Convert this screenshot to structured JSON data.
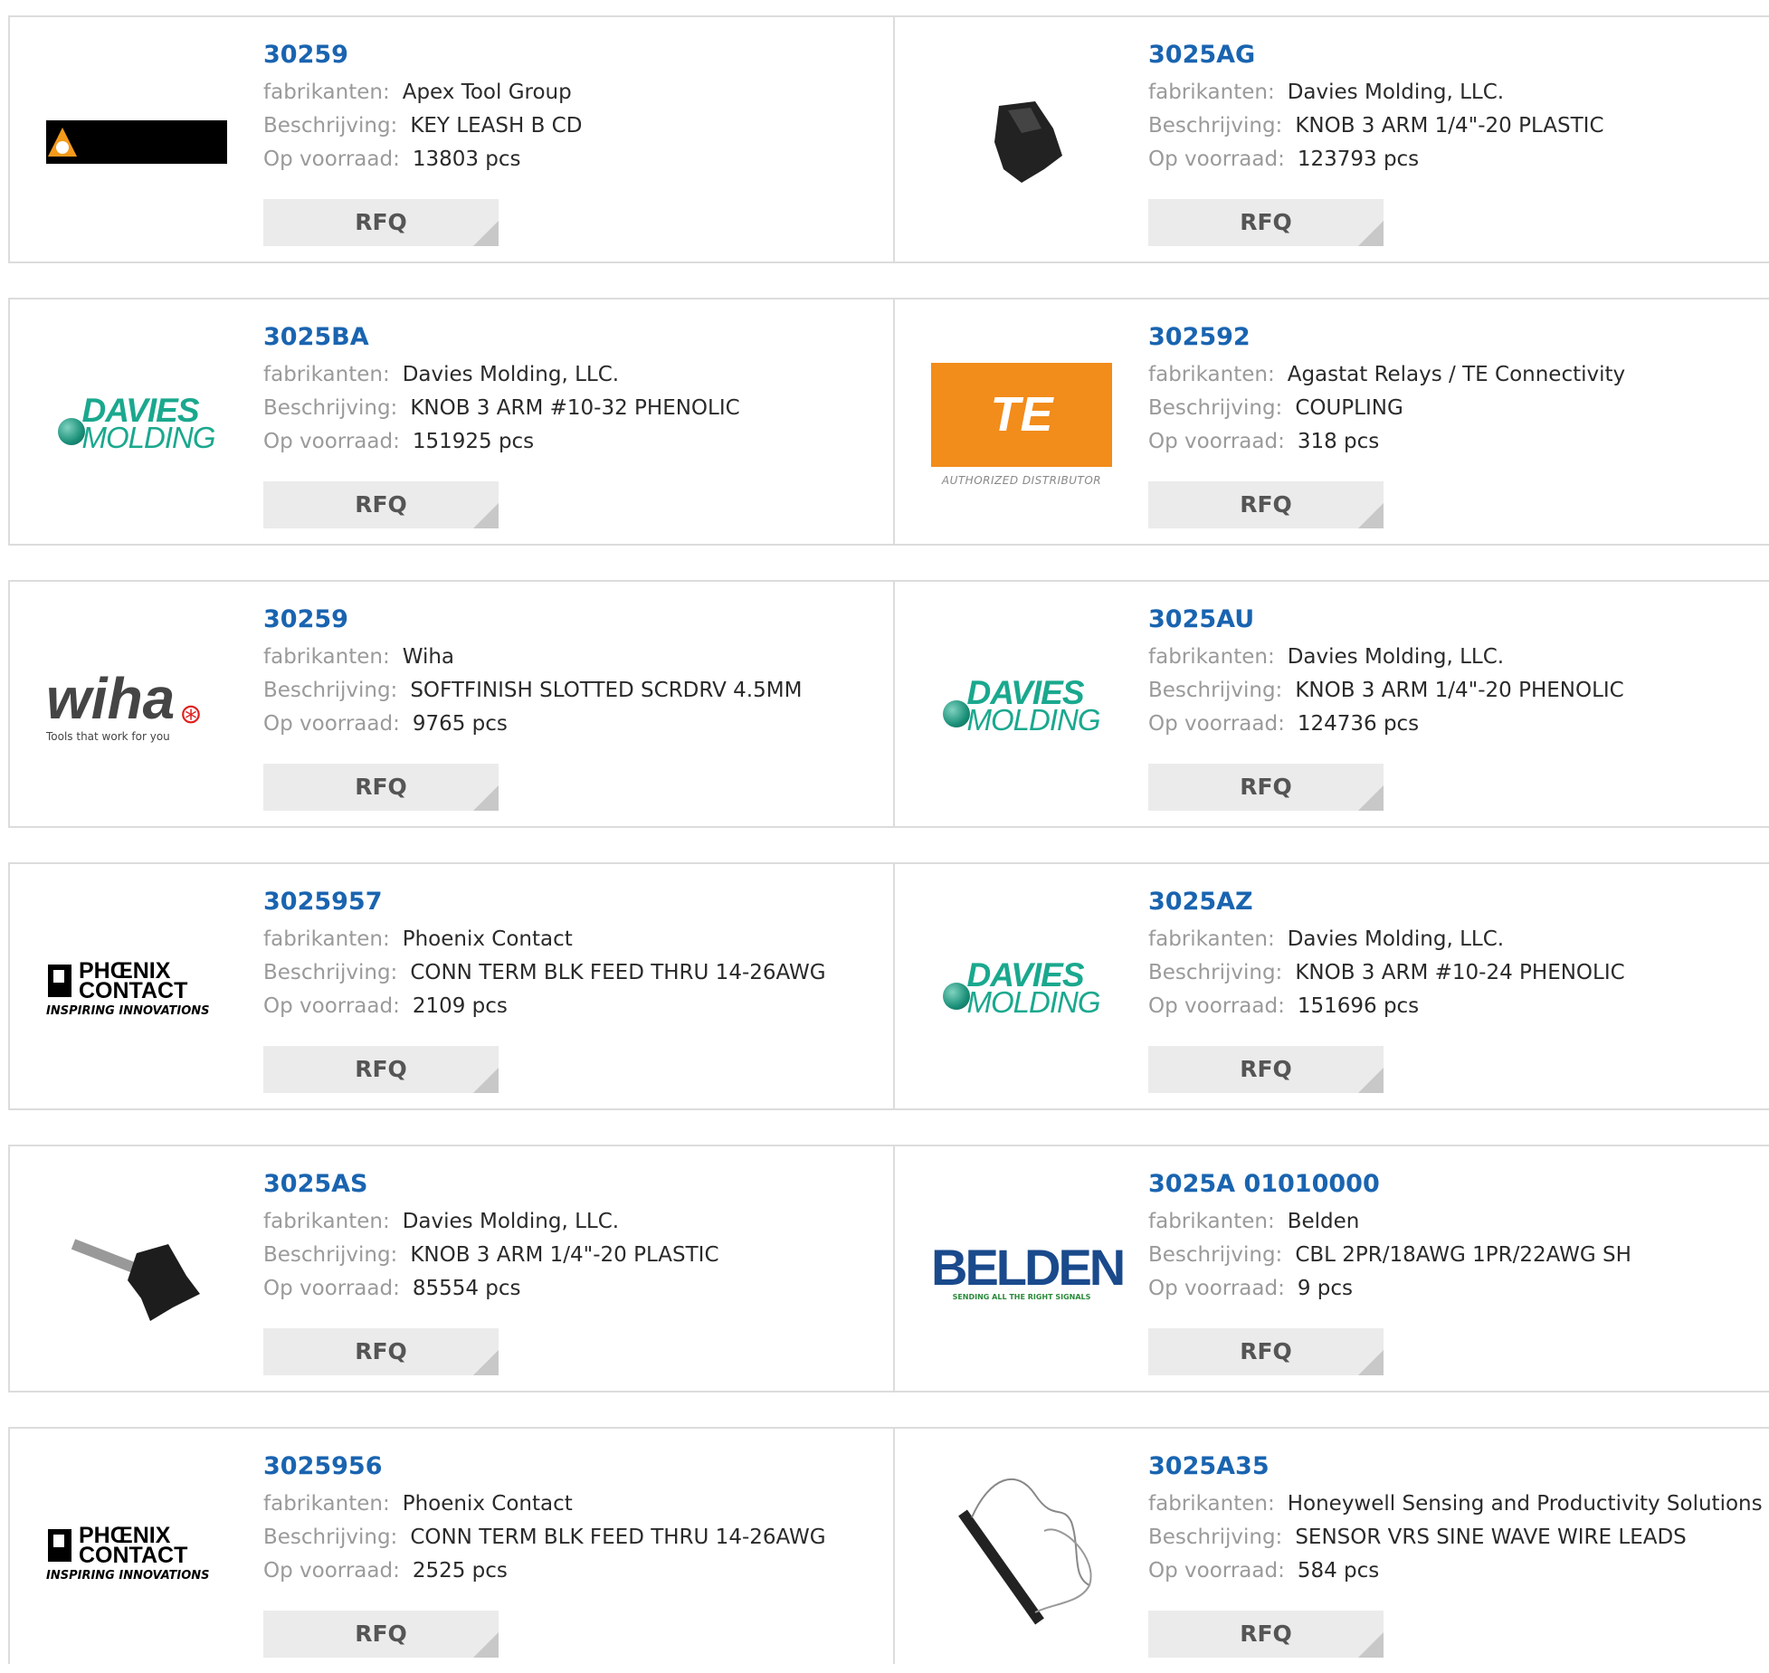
{
  "labels": {
    "manufacturer": "fabrikanten:",
    "description": "Beschrijving:",
    "stock": "Op voorraad:",
    "rfq": "RFQ"
  },
  "products": [
    {
      "part": "30259",
      "manufacturer": "Apex Tool Group",
      "description": "KEY LEASH B CD",
      "stock": "13803 pcs",
      "logo": "apex-logo"
    },
    {
      "part": "3025AG",
      "manufacturer": "Davies Molding, LLC.",
      "description": "KNOB 3 ARM 1/4\"-20 PLASTIC",
      "stock": "123793 pcs",
      "logo": "knob-photo"
    },
    {
      "part": "3025BA",
      "manufacturer": "Davies Molding, LLC.",
      "description": "KNOB 3 ARM #10-32 PHENOLIC",
      "stock": "151925 pcs",
      "logo": "davies-logo"
    },
    {
      "part": "302592",
      "manufacturer": "Agastat Relays / TE Connectivity",
      "description": "COUPLING",
      "stock": "318 pcs",
      "logo": "te-logo"
    },
    {
      "part": "30259",
      "manufacturer": "Wiha",
      "description": "SOFTFINISH SLOTTED SCRDRV 4.5MM",
      "stock": "9765 pcs",
      "logo": "wiha-logo"
    },
    {
      "part": "3025AU",
      "manufacturer": "Davies Molding, LLC.",
      "description": "KNOB 3 ARM 1/4\"-20 PHENOLIC",
      "stock": "124736 pcs",
      "logo": "davies-logo"
    },
    {
      "part": "3025957",
      "manufacturer": "Phoenix Contact",
      "description": "CONN TERM BLK FEED THRU 14-26AWG",
      "stock": "2109 pcs",
      "logo": "phoenix-logo"
    },
    {
      "part": "3025AZ",
      "manufacturer": "Davies Molding, LLC.",
      "description": "KNOB 3 ARM #10-24 PHENOLIC",
      "stock": "151696 pcs",
      "logo": "davies-logo"
    },
    {
      "part": "3025AS",
      "manufacturer": "Davies Molding, LLC.",
      "description": "KNOB 3 ARM 1/4\"-20 PLASTIC",
      "stock": "85554 pcs",
      "logo": "knob-screw-photo"
    },
    {
      "part": "3025A 01010000",
      "manufacturer": "Belden",
      "description": "CBL 2PR/18AWG 1PR/22AWG SH",
      "stock": "9 pcs",
      "logo": "belden-logo"
    },
    {
      "part": "3025956",
      "manufacturer": "Phoenix Contact",
      "description": "CONN TERM BLK FEED THRU 14-26AWG",
      "stock": "2525 pcs",
      "logo": "phoenix-logo"
    },
    {
      "part": "3025A35",
      "manufacturer": "Honeywell Sensing and Productivity Solutions",
      "description": "SENSOR VRS SINE WAVE WIRE LEADS",
      "stock": "584 pcs",
      "logo": "sensor-photo"
    }
  ],
  "logo_text": {
    "davies_line1": "DAVIES",
    "davies_line2": "MOLDING",
    "te_mark": "TE",
    "te_sub": "AUTHORIZED DISTRIBUTOR",
    "wiha_name": "wiha",
    "wiha_tagline": "Tools that work for you",
    "phoenix_line1": "PHŒNIX",
    "phoenix_line2": "CONTACT",
    "phoenix_tagline": "INSPIRING INNOVATIONS",
    "belden_name": "BELDEN",
    "belden_tagline": "SENDING ALL THE RIGHT SIGNALS"
  },
  "colors": {
    "part_number": "#1a64b0",
    "label": "#9a9a9a",
    "value": "#2a2a2a",
    "rfq_bg": "#ebebeb",
    "border": "#dcdcdc"
  }
}
